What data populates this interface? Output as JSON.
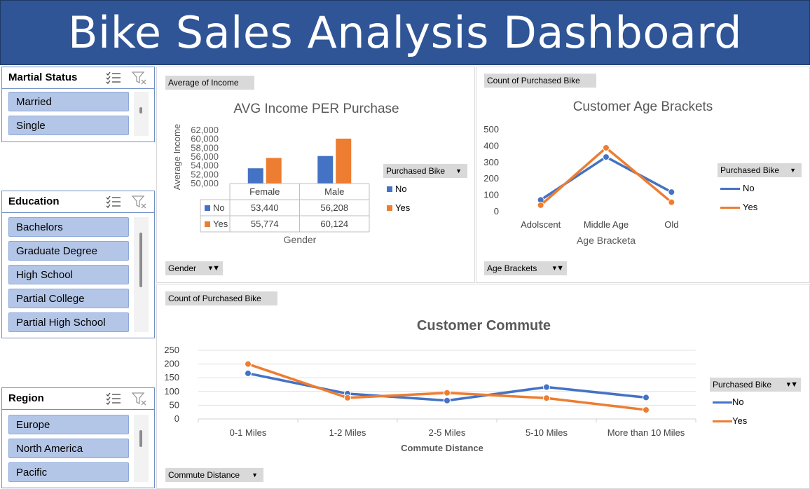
{
  "header": {
    "title": "Bike Sales Analysis Dashboard"
  },
  "slicers": {
    "marital": {
      "title": "Martial Status",
      "items": [
        "Married",
        "Single"
      ]
    },
    "education": {
      "title": "Education",
      "items": [
        "Bachelors",
        "Graduate Degree",
        "High School",
        "Partial College",
        "Partial High School"
      ]
    },
    "region": {
      "title": "Region",
      "items": [
        "Europe",
        "North America",
        "Pacific"
      ]
    }
  },
  "income_panel": {
    "value_field": "Average of Income",
    "axis_field": "Gender",
    "legend_field": "Purchased Bike",
    "legend": [
      "No",
      "Yes"
    ]
  },
  "age_panel": {
    "value_field": "Count of Purchased Bike",
    "axis_field": "Age Brackets",
    "legend_field": "Purchased Bike",
    "legend": [
      "No",
      "Yes"
    ]
  },
  "commute_panel": {
    "value_field": "Count of Purchased Bike",
    "axis_field": "Commute Distance",
    "legend_field": "Purchased Bike",
    "legend": [
      "No",
      "Yes"
    ]
  },
  "colors": {
    "header": "#2f5597",
    "no": "#4472c4",
    "yes": "#ed7d31",
    "slicer_item": "#b4c6e7"
  },
  "chart_data": [
    {
      "type": "bar",
      "title": "AVG Income PER Purchase",
      "xlabel": "Gender",
      "ylabel": "Average Income",
      "categories": [
        "Female",
        "Male"
      ],
      "series": [
        {
          "name": "No",
          "values": [
            53440,
            56208
          ],
          "labels": [
            "53,440",
            "56,208"
          ]
        },
        {
          "name": "Yes",
          "values": [
            55774,
            60124
          ],
          "labels": [
            "55,774",
            "60,124"
          ]
        }
      ],
      "ylim": [
        50000,
        62000
      ],
      "yticks": [
        "62,000",
        "60,000",
        "58,000",
        "56,000",
        "54,000",
        "52,000",
        "50,000"
      ],
      "data_table": true
    },
    {
      "type": "line",
      "title": "Customer Age Brackets",
      "xlabel": "Age Bracketa",
      "ylabel": "",
      "categories": [
        "Adolscent",
        "Middle Age",
        "Old"
      ],
      "series": [
        {
          "name": "No",
          "values": [
            71,
            333,
            119
          ]
        },
        {
          "name": "Yes",
          "values": [
            39,
            389,
            57
          ]
        }
      ],
      "ylim": [
        0,
        500
      ],
      "yticks": [
        "500",
        "400",
        "300",
        "200",
        "100",
        "0"
      ]
    },
    {
      "type": "line",
      "title": "Customer Commute",
      "xlabel": "Commute Distance",
      "ylabel": "",
      "categories": [
        "0-1 Miles",
        "1-2 Miles",
        "2-5 Miles",
        "5-10 Miles",
        "More than 10 Miles"
      ],
      "series": [
        {
          "name": "No",
          "values": [
            166,
            92,
            67,
            116,
            78
          ]
        },
        {
          "name": "Yes",
          "values": [
            200,
            77,
            95,
            76,
            33
          ]
        }
      ],
      "ylim": [
        0,
        250
      ],
      "yticks": [
        "250",
        "200",
        "150",
        "100",
        "50",
        "0"
      ],
      "grid": true
    }
  ]
}
